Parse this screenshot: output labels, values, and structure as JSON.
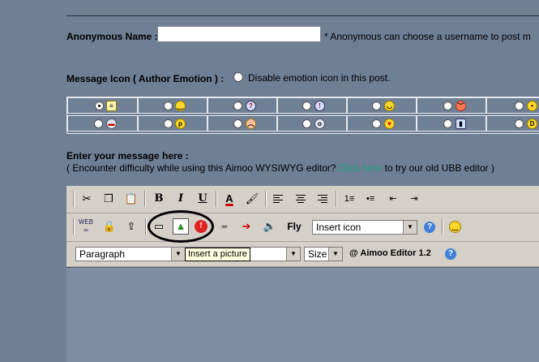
{
  "form": {
    "name_label": "Anonymous Name :",
    "name_note": "* Anonymous can choose a username to post m",
    "icon_label": "Message Icon ( Author Emotion ) :",
    "disable_label": "Disable emotion icon in this post.",
    "message_label": "Enter your message here :",
    "hint_before": "( Encounter difficulty while using this Aimoo WYSIWYG editor? ",
    "hint_link": "Click here",
    "hint_after": " to try our old UBB editor )"
  },
  "emotions": {
    "row1": [
      "doc",
      "smile",
      "question",
      "exclaim",
      "cool",
      "angry",
      "idea"
    ],
    "row2": [
      "flag",
      "tongue",
      "sad",
      "shock",
      "love",
      "chart",
      "grin"
    ],
    "selected": "doc"
  },
  "editor": {
    "toolbar1": {
      "bold": "B",
      "italic": "I",
      "underline": "U"
    },
    "toolbar2": {
      "fly_label": "Fly",
      "insert_icon_value": "Insert icon",
      "help": "?"
    },
    "toolbar3": {
      "format_value": "Paragraph",
      "size_value": "Size",
      "brand": "@ Aimoo Editor 1.2",
      "help": "?"
    },
    "tooltip": "Insert a picture"
  },
  "colors": {
    "background": "#6f7f94",
    "toolbar": "#d4d0c8",
    "link": "#1fa37a",
    "tooltip": "#ffffe1"
  }
}
